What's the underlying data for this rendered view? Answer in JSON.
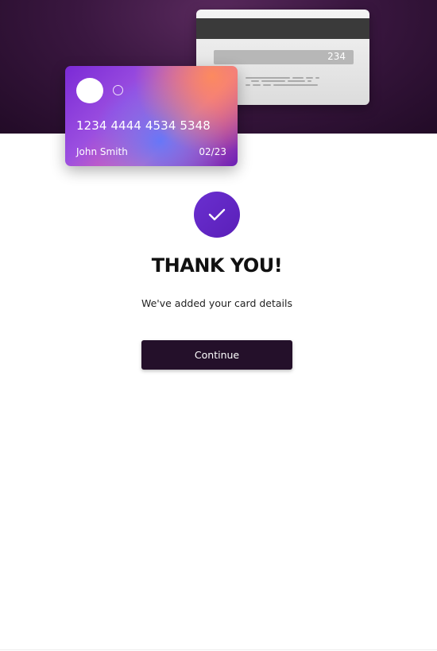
{
  "card_back": {
    "cvv": "234"
  },
  "card_front": {
    "number": "1234 4444 4534 5348",
    "holder": "John Smith",
    "expiry": "02/23"
  },
  "confirmation": {
    "icon": "check-icon",
    "heading": "THANK YOU!",
    "message": "We've added your card details",
    "button_label": "Continue"
  },
  "colors": {
    "hero_background": "#2a0f30",
    "accent_purple": "#5f27c4",
    "button_background": "#24102a",
    "card_gradient": [
      "#7b2ad6",
      "#e36ab0",
      "#5a7bff"
    ]
  }
}
